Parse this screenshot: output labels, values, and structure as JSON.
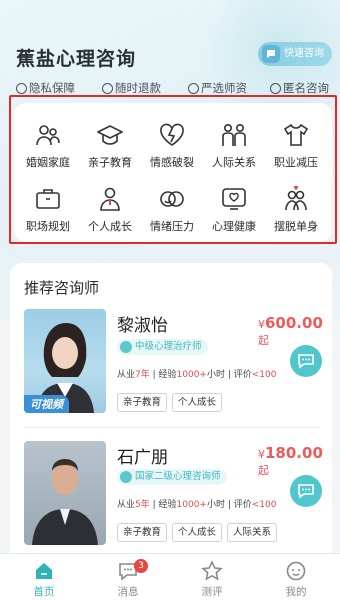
{
  "header": {
    "title": "蕉盐心理咨询",
    "quick_consult": "快速咨询",
    "features": [
      "隐私保障",
      "随时退款",
      "严选师资",
      "匿名咨询"
    ]
  },
  "categories": [
    {
      "label": "婚姻家庭",
      "icon": "family-icon"
    },
    {
      "label": "亲子教育",
      "icon": "graduation-cap-icon"
    },
    {
      "label": "情感破裂",
      "icon": "broken-heart-icon"
    },
    {
      "label": "人际关系",
      "icon": "people-icon"
    },
    {
      "label": "职业减压",
      "icon": "shirt-icon"
    },
    {
      "label": "职场规划",
      "icon": "briefcase-icon"
    },
    {
      "label": "个人成长",
      "icon": "person-icon"
    },
    {
      "label": "情绪压力",
      "icon": "smile-face-icon"
    },
    {
      "label": "心理健康",
      "icon": "heart-message-icon"
    },
    {
      "label": "摆脱单身",
      "icon": "couple-icon"
    }
  ],
  "recommend": {
    "title": "推荐咨询师",
    "counselors": [
      {
        "name": "黎淑怡",
        "price": "600.00",
        "price_prefix": "¥",
        "price_suffix": "起",
        "badge": "中级心理治疗师",
        "meta_years_label": "从业",
        "years": "7年",
        "meta_exp_label": " | 经验",
        "experience": "1000+",
        "meta_hours": "小时 | 评价",
        "rating": "<100",
        "tags": [
          "亲子教育",
          "个人成长"
        ],
        "video_tag": "可视频"
      },
      {
        "name": "石广朋",
        "price": "180.00",
        "price_prefix": "¥",
        "price_suffix": "起",
        "badge": "国家二级心理咨询师",
        "meta_years_label": "从业",
        "years": "5年",
        "meta_exp_label": " | 经验",
        "experience": "1000+",
        "meta_hours": "小时 | 评价",
        "rating": "<100",
        "tags": [
          "亲子教育",
          "个人成长",
          "人际关系"
        ]
      }
    ]
  },
  "tabbar": {
    "items": [
      {
        "label": "首页",
        "icon": "home-icon",
        "active": true
      },
      {
        "label": "消息",
        "icon": "message-icon",
        "badge": "3"
      },
      {
        "label": "测评",
        "icon": "star-icon"
      },
      {
        "label": "我的",
        "icon": "profile-icon"
      }
    ]
  },
  "colors": {
    "accent": "#2fb3b9",
    "price": "#ef5a5a",
    "highlight_border": "#e02a2a"
  }
}
